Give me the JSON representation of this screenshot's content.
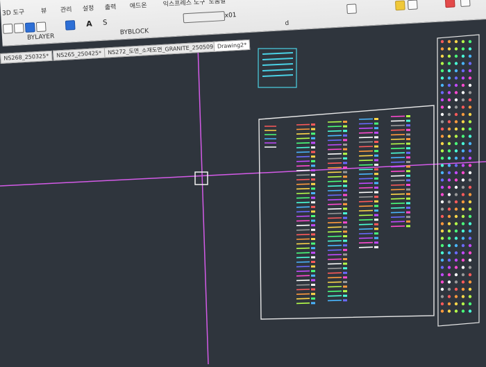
{
  "menu": {
    "items": [
      "3D 도구",
      "뷰",
      "관리",
      "설정",
      "출력",
      "애드온",
      "익스프레스 도구",
      "도움말"
    ]
  },
  "toolbar": {
    "text_style": "S",
    "layer_left": "BYLAYER",
    "layer_right": "BYBLOCK",
    "scale": "x01",
    "label_d": "d"
  },
  "tabs": [
    {
      "label": "NS268_250325*"
    },
    {
      "label": "NS265_250425*"
    },
    {
      "label": "NS272_도면_소재도면_GRANITE_250509"
    },
    {
      "label": "Drawing2*"
    }
  ],
  "tab_controls": {
    "close": "×",
    "add": "+"
  },
  "colors": {
    "crosshair": "#d45be8",
    "background": "#2f353d",
    "frame": "#e0e0e0"
  }
}
